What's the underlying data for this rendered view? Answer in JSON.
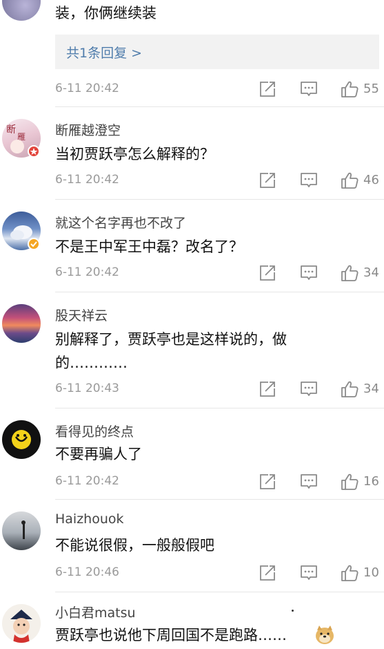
{
  "comments": [
    {
      "text": "装，你俩继续装",
      "replies_label": "共1条回复 >",
      "time": "6-11 20:42",
      "likes": "55"
    },
    {
      "username": "断雁越澄空",
      "text": "当初贾跃亭怎么解释的？",
      "time": "6-11 20:42",
      "likes": "46"
    },
    {
      "username": "就这个名字再也不改了",
      "text": "不是王中军王中磊？改名了？",
      "time": "6-11 20:42",
      "likes": "34"
    },
    {
      "username": "股天祥云",
      "text": "别解释了，贾跃亭也是这样说的，做的…………",
      "time": "6-11 20:43",
      "likes": "34"
    },
    {
      "username": "看得见的终点",
      "text": "不要再骗人了",
      "time": "6-11 20:42",
      "likes": "16"
    },
    {
      "username": "Haizhouok",
      "text": "不能说很假，一般般假吧",
      "time": "6-11 20:46",
      "likes": "10"
    },
    {
      "username": "小白君matsu",
      "text": "贾跃亭也说他下周回国不是跑路……"
    }
  ],
  "icons": {
    "repost": "share-icon",
    "comment": "comment-icon",
    "like": "thumbs-up-icon"
  },
  "colors": {
    "link": "#507dac",
    "meta": "#9a9a9a",
    "divider": "#e6e6e6",
    "reply_bg": "#f2f2f2",
    "verified_badge": "#f5a623",
    "red_badge": "#e2453c"
  }
}
